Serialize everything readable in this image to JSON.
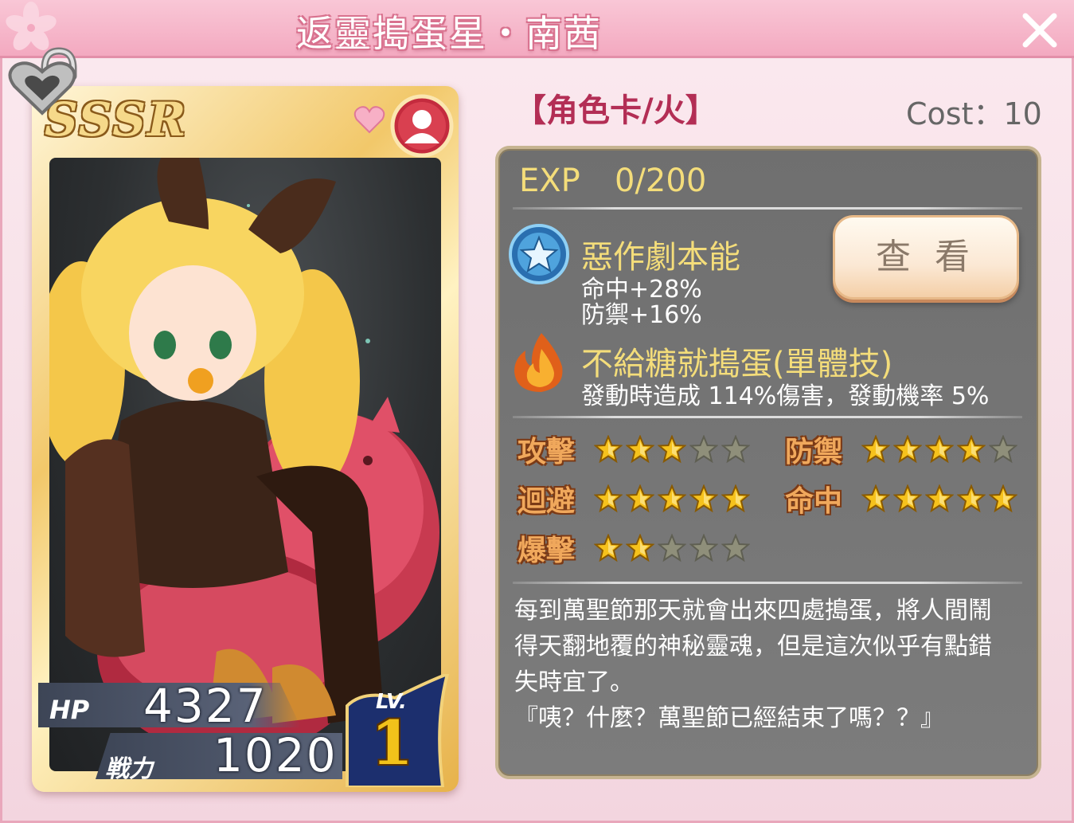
{
  "window": {
    "title": "返靈搗蛋星・南茜",
    "close_label": "close"
  },
  "card": {
    "rarity": "SSSR",
    "hp_label": "HP",
    "hp": "4327",
    "power_label": "戦力",
    "power": "1020",
    "lv_label": "LV.",
    "lv": "1"
  },
  "info": {
    "type": "【角色卡/火】",
    "cost": "Cost：10",
    "exp_label": "EXP",
    "exp_value": "0/200"
  },
  "skill_passive": {
    "icon": "star-badge-icon",
    "name": "惡作劇本能",
    "lines": [
      "命中+28%",
      "防禦+16%"
    ],
    "view_button": "查 看"
  },
  "skill_active": {
    "icon": "flame-icon",
    "name": "不給糖就搗蛋(單體技)",
    "desc": "發動時造成 114%傷害，發動機率 5%"
  },
  "stats": [
    {
      "label": "攻擊",
      "value": 3,
      "max": 5
    },
    {
      "label": "防禦",
      "value": 4,
      "max": 5
    },
    {
      "label": "迴避",
      "value": 5,
      "max": 5
    },
    {
      "label": "命中",
      "value": 5,
      "max": 5
    },
    {
      "label": "爆擊",
      "value": 2,
      "max": 5
    }
  ],
  "description": {
    "lines": [
      "每到萬聖節那天就會出來四處搗蛋，將人間鬧",
      "得天翻地覆的神秘靈魂，但是這次似乎有點錯",
      "失時宜了。",
      "『咦？什麼？萬聖節已經結束了嗎？？』"
    ]
  },
  "colors": {
    "title_bar": "#f3a9c0",
    "accent_gold": "#f4dd7a",
    "panel": "#767676",
    "stat_label": "#f0a85c",
    "type_label": "#b32e55"
  }
}
